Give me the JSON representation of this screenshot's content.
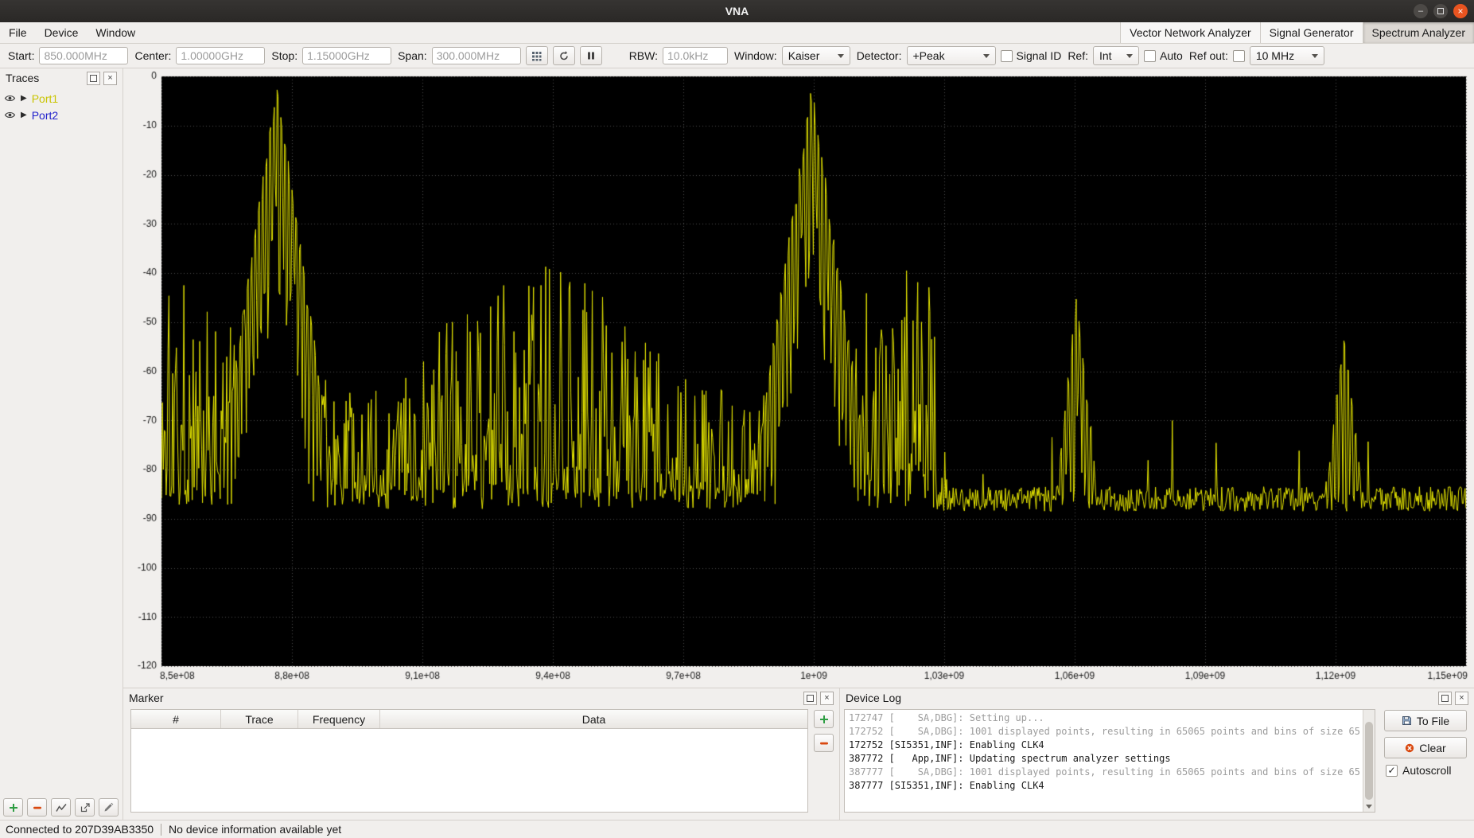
{
  "window": {
    "title": "VNA"
  },
  "icons": {
    "close_glyph": "×",
    "minimize_glyph": "–",
    "check_glyph": "✓",
    "collapsed_glyph": "▶"
  },
  "menu": {
    "items": [
      "File",
      "Device",
      "Window"
    ]
  },
  "mode_tabs": [
    {
      "label": "Vector Network Analyzer",
      "active": false
    },
    {
      "label": "Signal Generator",
      "active": false
    },
    {
      "label": "Spectrum Analyzer",
      "active": true
    }
  ],
  "toolbar": {
    "start_label": "Start:",
    "start_value": "850.000MHz",
    "center_label": "Center:",
    "center_value": "1.00000GHz",
    "stop_label": "Stop:",
    "stop_value": "1.15000GHz",
    "span_label": "Span:",
    "span_value": "300.000MHz",
    "rbw_label": "RBW:",
    "rbw_value": "10.0kHz",
    "window_label": "Window:",
    "window_value": "Kaiser",
    "detector_label": "Detector:",
    "detector_value": "+Peak",
    "signal_id_label": "Signal ID",
    "ref_label": "Ref:",
    "ref_value": "Int",
    "auto_label": "Auto",
    "ref_out_label": "Ref out:",
    "ref_out_value": "10 MHz"
  },
  "traces_panel": {
    "title": "Traces",
    "items": [
      {
        "label": "Port1",
        "color": "#c9c400"
      },
      {
        "label": "Port2",
        "color": "#2121cc"
      }
    ]
  },
  "marker_panel": {
    "title": "Marker",
    "columns": [
      "#",
      "Trace",
      "Frequency",
      "Data"
    ]
  },
  "device_log": {
    "title": "Device Log",
    "entries": [
      {
        "text": "172747 [    SA,DBG]: Setting up...",
        "muted": true
      },
      {
        "text": "172752 [    SA,DBG]: 1001 displayed points, resulting in 65065 points and bins of size 65",
        "muted": true
      },
      {
        "text": "172752 [SI5351,INF]: Enabling CLK4",
        "muted": false
      },
      {
        "text": "387772 [   App,INF]: Updating spectrum analyzer settings",
        "muted": false
      },
      {
        "text": "387777 [    SA,DBG]: 1001 displayed points, resulting in 65065 points and bins of size 65",
        "muted": true
      },
      {
        "text": "387777 [SI5351,INF]: Enabling CLK4",
        "muted": false
      }
    ],
    "to_file_label": "To File",
    "clear_label": "Clear",
    "autoscroll_label": "Autoscroll",
    "autoscroll_checked": true
  },
  "status_bar": {
    "left": "Connected to 207D39AB3350",
    "right": "No device information available yet"
  },
  "chart_data": {
    "type": "line",
    "title": "",
    "xlabel": "",
    "ylabel": "",
    "x_axis": {
      "min": 850000000,
      "max": 1150000000,
      "tick_labels": [
        "8,5e+08",
        "8,8e+08",
        "9,1e+08",
        "9,4e+08",
        "9,7e+08",
        "1e+09",
        "1,03e+09",
        "1,06e+09",
        "1,09e+09",
        "1,12e+09",
        "1,15e+09"
      ]
    },
    "y_axis": {
      "min": -120,
      "max": 0,
      "tick_step": 10,
      "tick_labels": [
        "0",
        "-10",
        "-20",
        "-30",
        "-40",
        "-50",
        "-60",
        "-70",
        "-80",
        "-90",
        "-100",
        "-110",
        "-120"
      ]
    },
    "background": "#000000",
    "grid_color": "#4f4f4f",
    "trace_color": "#e6e600",
    "series": [
      {
        "name": "Port1",
        "color": "#e6e600"
      }
    ],
    "noise_floor_db": -86,
    "peaks": [
      {
        "center_hz": 876500000,
        "top_db": -1,
        "halfwidth_hz": 16000000
      },
      {
        "center_hz": 999500000,
        "top_db": -1.5,
        "halfwidth_hz": 16000000
      },
      {
        "center_hz": 1060500000,
        "top_db": -44,
        "halfwidth_hz": 6500000
      },
      {
        "center_hz": 1122000000,
        "top_db": -51,
        "halfwidth_hz": 6000000
      }
    ],
    "synth": {
      "seed": 1337,
      "points": 1400,
      "floor_db": -86,
      "floor_jitter_db": 5,
      "dense_region": [
        850000000,
        1028000000
      ],
      "dense_base_db": -88,
      "dense_amp_db": 50,
      "dense_pow": 1.9,
      "spur_prob": 0.04,
      "spur_amp_db": 16,
      "skirt_floor_db": -97
    }
  }
}
